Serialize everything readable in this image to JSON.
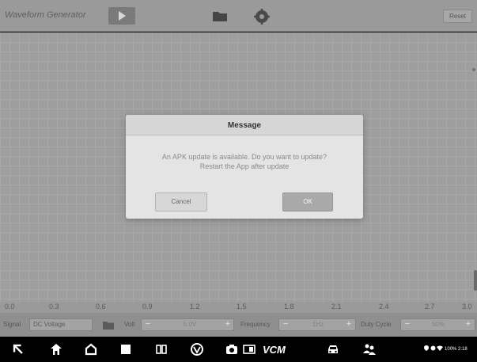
{
  "app": {
    "title": "Waveform Generator",
    "reset_label": "Reset"
  },
  "axis": {
    "ticks": [
      "0.0",
      "0.3",
      "0.6",
      "0.9",
      "1.2",
      "1.5",
      "1.8",
      "2.1",
      "2.4",
      "2.7",
      "3.0"
    ]
  },
  "controls": {
    "signal_label": "Signal",
    "signal_value": "DC Voltage",
    "volt_label": "Volt",
    "volt_value": "5.0V",
    "frequency_label": "Frequency",
    "frequency_value": "1Hz",
    "duty_cycle_label": "Duty Cycle",
    "duty_cycle_value": "50%"
  },
  "dialog": {
    "title": "Message",
    "message_line1": "An APK update is available. Do you want to update?",
    "message_line2": "Restart the App after update",
    "cancel_label": "Cancel",
    "ok_label": "OK"
  },
  "navbar": {
    "vcm_label": "VCM",
    "status_text": "100% 2:18"
  },
  "icons": {
    "play": "play-icon",
    "folder": "folder-icon",
    "settings": "settings-icon",
    "back": "back-icon",
    "home": "home-icon",
    "recents": "recents-icon",
    "split": "split-screen-icon",
    "browser": "browser-icon",
    "camera": "camera-icon",
    "screen": "screen-mirror-icon",
    "car": "car-icon",
    "users": "users-icon"
  }
}
